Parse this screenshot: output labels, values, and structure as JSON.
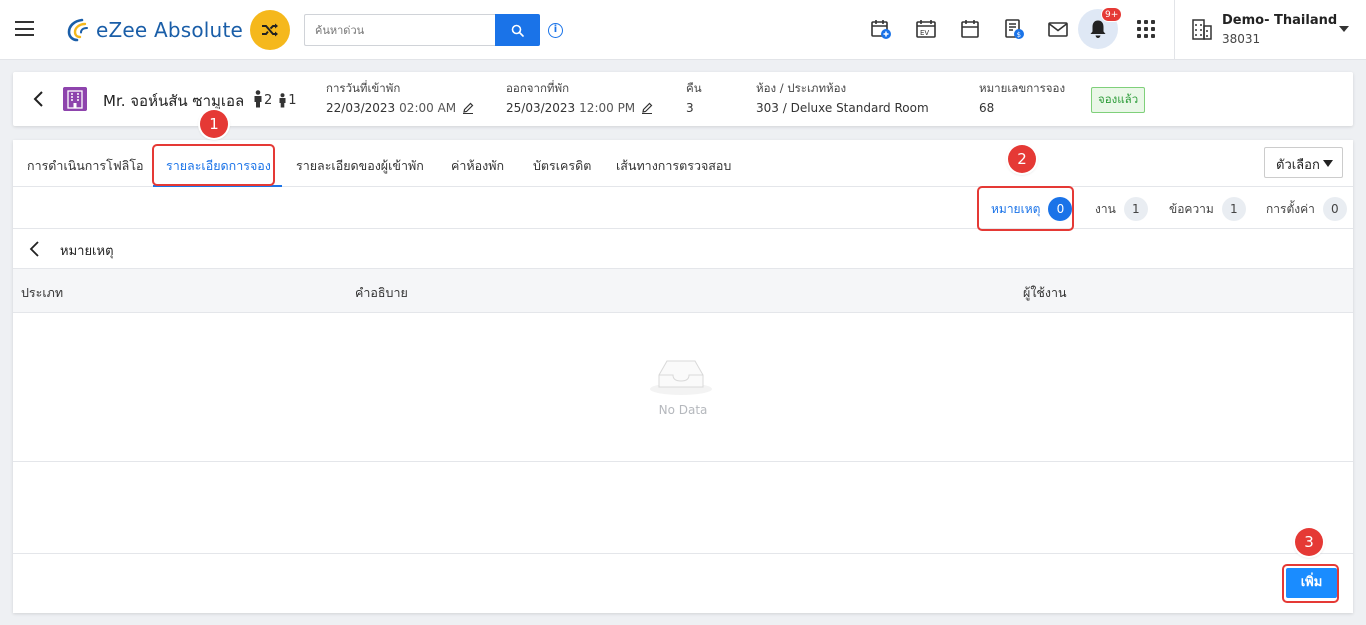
{
  "topbar": {
    "brand": "eZee Absolute",
    "search_placeholder": "ค้นหาด่วน",
    "notification_badge": "9+",
    "property_name": "Demo- Thailand",
    "property_code": "38031",
    "icons": [
      "menu-icon",
      "shuffle-icon",
      "search-icon",
      "info-icon",
      "calendar-add-icon",
      "ev-calendar-icon",
      "calendar-icon",
      "billing-icon",
      "mail-icon",
      "bell-icon",
      "apps-grid-icon",
      "building-icon"
    ]
  },
  "booking": {
    "guest_name": "Mr. จอห์นสัน ซามูเอล",
    "adults": "2",
    "children": "1",
    "checkin_label": "การวันที่เข้าพัก",
    "checkin_date": "22/03/2023",
    "checkin_time": "02:00 AM",
    "checkout_label": "ออกจากที่พัก",
    "checkout_date": "25/03/2023",
    "checkout_time": "12:00 PM",
    "nights_label": "คืน",
    "nights": "3",
    "room_label": "ห้อง / ประเภทห้อง",
    "room_value": "303 / Deluxe Standard Room",
    "res_no_label": "หมายเลขการจอง",
    "res_no": "68",
    "status": "จองแล้ว",
    "status_color": "#2e9d3a"
  },
  "tabs": [
    {
      "label": "การดำเนินการโฟลิโอ"
    },
    {
      "label": "รายละเอียดการจอง"
    },
    {
      "label": "รายละเอียดของผู้เข้าพัก"
    },
    {
      "label": "ค่าห้องพัก"
    },
    {
      "label": "บัตรเครดิต"
    },
    {
      "label": "เส้นทางการตรวจสอบ"
    }
  ],
  "options_label": "ตัวเลือก",
  "subtabs": [
    {
      "label": "หมายเหตุ",
      "count": "0"
    },
    {
      "label": "งาน",
      "count": "1"
    },
    {
      "label": "ข้อความ",
      "count": "1"
    },
    {
      "label": "การตั้งค่า",
      "count": "0"
    }
  ],
  "section_title": "หมายเหตุ",
  "table": {
    "columns": [
      "ประเภท",
      "คำอธิบาย",
      "ผู้ใช้งาน"
    ],
    "empty_text": "No Data"
  },
  "add_button": "เพิ่ม",
  "annotations": {
    "step1": "1",
    "step2": "2",
    "step3": "3"
  },
  "colors": {
    "accent": "#1a73e8",
    "highlight": "#e53935",
    "brand": "#1a5ea8"
  }
}
